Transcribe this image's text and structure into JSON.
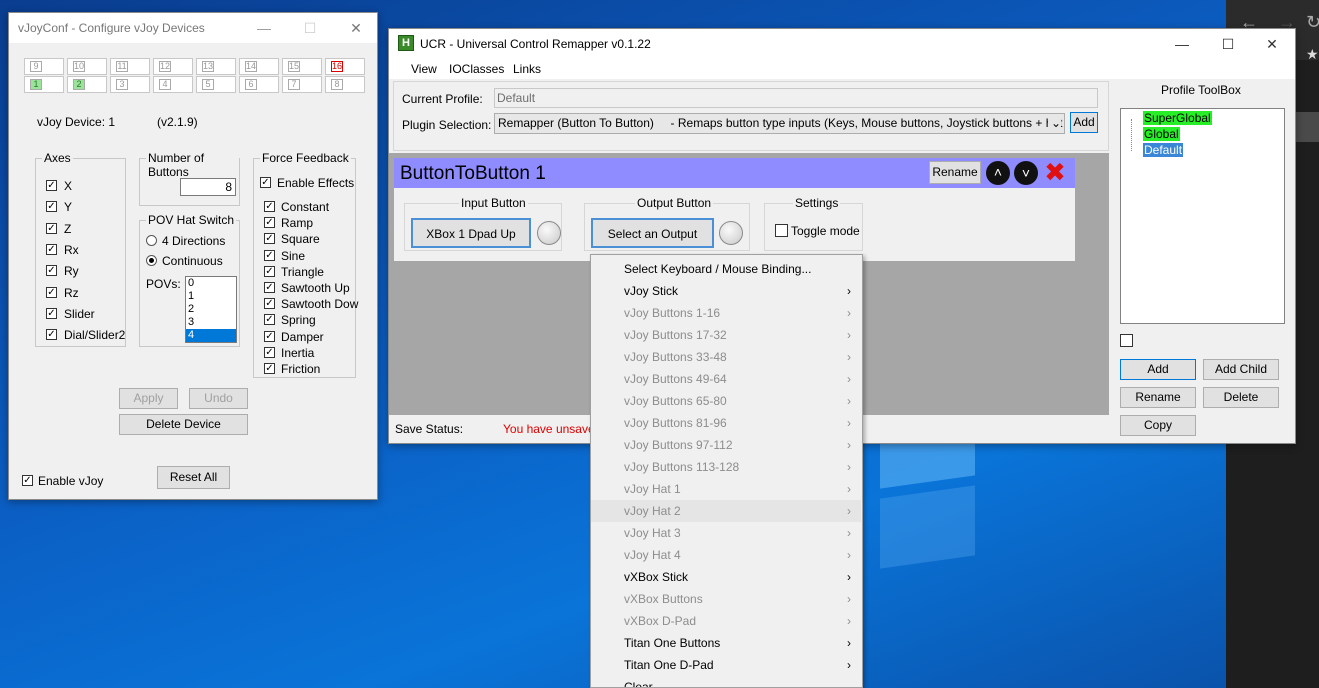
{
  "colors": {
    "desktop": "#0a5bc2",
    "header_purple": "#8f8cff",
    "tree_green": "#27ee27",
    "tree_selected": "#3a87d8",
    "unsaved_red": "#e00000"
  },
  "vjoy": {
    "title": "vJoyConf - Configure vJoy Devices",
    "tabs_top": [
      "9",
      "10",
      "11",
      "12",
      "13",
      "14",
      "15",
      "16"
    ],
    "tabs_bottom": [
      "1",
      "2",
      "3",
      "4",
      "5",
      "6",
      "7",
      "8"
    ],
    "device_label": "vJoy Device: 1",
    "version": "(v2.1.9)",
    "axes_title": "Axes",
    "axes": [
      {
        "label": "X",
        "checked": true
      },
      {
        "label": "Y",
        "checked": true
      },
      {
        "label": "Z",
        "checked": true
      },
      {
        "label": "Rx",
        "checked": true
      },
      {
        "label": "Ry",
        "checked": true
      },
      {
        "label": "Rz",
        "checked": true
      },
      {
        "label": "Slider",
        "checked": true
      },
      {
        "label": "Dial/Slider2",
        "checked": true
      }
    ],
    "buttons_title": "Number of Buttons",
    "buttons_value": "8",
    "pov_title": "POV Hat Switch",
    "pov_options": [
      {
        "label": "4 Directions",
        "selected": false
      },
      {
        "label": "Continuous",
        "selected": true
      }
    ],
    "povs_label": "POVs:",
    "povs_list": [
      "0",
      "1",
      "2",
      "3",
      "4"
    ],
    "povs_selected": "4",
    "ff_title": "Force Feedback",
    "ff_enable": "Enable Effects",
    "ff_effects": [
      "Constant",
      "Ramp",
      "Square",
      "Sine",
      "Triangle",
      "Sawtooth Up",
      "Sawtooth Dow",
      "Spring",
      "Damper",
      "Inertia",
      "Friction"
    ],
    "apply": "Apply",
    "undo": "Undo",
    "delete_device": "Delete Device",
    "enable_vjoy": "Enable vJoy",
    "reset_all": "Reset All"
  },
  "ucr": {
    "title": "UCR - Universal Control Remapper v0.1.22",
    "menu": [
      "View",
      "IOClasses",
      "Links"
    ],
    "current_profile_label": "Current Profile:",
    "current_profile_value": "Default",
    "plugin_label": "Plugin Selection:",
    "plugin_value": "Remapper (Button To Button)     - Remaps button type inputs (Keys, Mouse buttons, Joystick buttons + hat directions",
    "add": "Add",
    "plugin_name": "ButtonToButton 1",
    "rename": "Rename",
    "input_button_title": "Input Button",
    "input_button_value": "XBox 1 Dpad Up",
    "output_button_title": "Output Button",
    "output_button_value": "Select an Output Button",
    "settings_title": "Settings",
    "toggle_mode": "Toggle mode",
    "save_status_label": "Save Status:",
    "save_status_value": "You have unsaved"
  },
  "toolbox": {
    "title": "Profile ToolBox",
    "tree": [
      "SuperGlobal",
      "Global",
      "Default"
    ],
    "add": "Add",
    "add_child": "Add Child",
    "rename": "Rename",
    "delete": "Delete",
    "copy": "Copy"
  },
  "context_menu": {
    "items": [
      {
        "label": "Select Keyboard / Mouse Binding...",
        "enabled": true,
        "submenu": false
      },
      {
        "label": "vJoy Stick",
        "enabled": true,
        "submenu": true
      },
      {
        "label": "vJoy Buttons 1-16",
        "enabled": false,
        "submenu": true
      },
      {
        "label": "vJoy Buttons 17-32",
        "enabled": false,
        "submenu": true
      },
      {
        "label": "vJoy Buttons 33-48",
        "enabled": false,
        "submenu": true
      },
      {
        "label": "vJoy Buttons 49-64",
        "enabled": false,
        "submenu": true
      },
      {
        "label": "vJoy Buttons 65-80",
        "enabled": false,
        "submenu": true
      },
      {
        "label": "vJoy Buttons 81-96",
        "enabled": false,
        "submenu": true
      },
      {
        "label": "vJoy Buttons 97-112",
        "enabled": false,
        "submenu": true
      },
      {
        "label": "vJoy Buttons 113-128",
        "enabled": false,
        "submenu": true
      },
      {
        "label": "vJoy Hat 1",
        "enabled": false,
        "submenu": true
      },
      {
        "label": "vJoy Hat 2",
        "enabled": false,
        "submenu": true,
        "hover": true
      },
      {
        "label": "vJoy Hat 3",
        "enabled": false,
        "submenu": true
      },
      {
        "label": "vJoy Hat 4",
        "enabled": false,
        "submenu": true
      },
      {
        "label": "vXBox Stick",
        "enabled": true,
        "submenu": true
      },
      {
        "label": "vXBox Buttons",
        "enabled": false,
        "submenu": true
      },
      {
        "label": "vXBox D-Pad",
        "enabled": false,
        "submenu": true
      },
      {
        "label": "Titan One Buttons",
        "enabled": true,
        "submenu": true
      },
      {
        "label": "Titan One D-Pad",
        "enabled": true,
        "submenu": true
      },
      {
        "label": "Clear",
        "enabled": true,
        "submenu": false
      }
    ]
  }
}
